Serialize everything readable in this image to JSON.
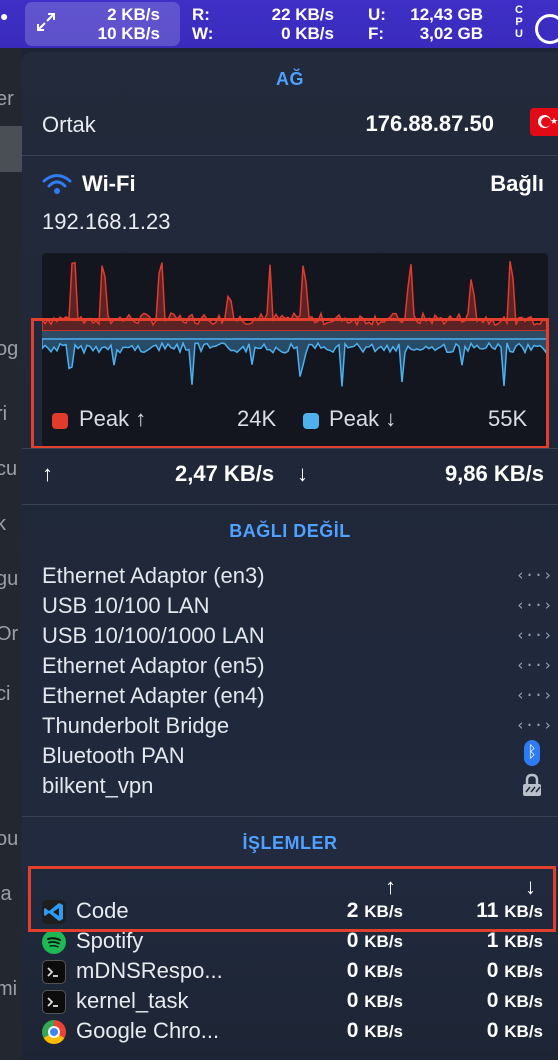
{
  "menubar": {
    "net_up": "2 KB/s",
    "net_down": "10 KB/s",
    "disk_r_label": "R:",
    "disk_r_value": "22 KB/s",
    "disk_w_label": "W:",
    "disk_w_value": "0 KB/s",
    "mem_u_label": "U:",
    "mem_u_value": "12,43 GB",
    "mem_f_label": "F:",
    "mem_f_value": "3,02 GB",
    "cpu_label": "CPU"
  },
  "network": {
    "title": "AĞ",
    "public_label": "Ortak",
    "public_ip": "176.88.87.50",
    "flag_icon": "turkey-flag-icon",
    "wifi_label": "Wi-Fi",
    "wifi_status": "Bağlı",
    "local_ip": "192.168.1.23",
    "legend_up_label": "Peak ↑",
    "legend_up_value": "24K",
    "legend_down_label": "Peak ↓",
    "legend_down_value": "55K",
    "up_arrow": "↑",
    "up_speed": "2,47 KB/s",
    "down_arrow": "↓",
    "down_speed": "9,86 KB/s",
    "colors": {
      "upload": "#e23b2e",
      "download": "#4fb0ee",
      "section_title": "#4fa0ff"
    }
  },
  "disconnected": {
    "title": "BAĞLI DEĞİL",
    "adapters": [
      {
        "name": "Ethernet Adaptor (en3)",
        "icon": "ethernet-icon"
      },
      {
        "name": "USB 10/100 LAN",
        "icon": "ethernet-icon"
      },
      {
        "name": "USB 10/100/1000 LAN",
        "icon": "ethernet-icon"
      },
      {
        "name": "Ethernet Adaptor (en5)",
        "icon": "ethernet-icon"
      },
      {
        "name": "Ethernet Adapter (en4)",
        "icon": "ethernet-icon"
      },
      {
        "name": "Thunderbolt Bridge",
        "icon": "ethernet-icon"
      },
      {
        "name": "Bluetooth PAN",
        "icon": "bluetooth-icon"
      },
      {
        "name": "bilkent_vpn",
        "icon": "vpn-lock-icon"
      }
    ]
  },
  "processes": {
    "title": "İŞLEMLER",
    "up_header": "↑",
    "down_header": "↓",
    "unit": "KB/s",
    "rows": [
      {
        "name": "Code",
        "up": "2",
        "down": "11",
        "icon": "vscode-icon"
      },
      {
        "name": "Spotify",
        "up": "0",
        "down": "1",
        "icon": "spotify-icon"
      },
      {
        "name": "mDNSRespo...",
        "up": "0",
        "down": "0",
        "icon": "terminal-icon"
      },
      {
        "name": "kernel_task",
        "up": "0",
        "down": "0",
        "icon": "terminal-icon"
      },
      {
        "name": "Google Chro...",
        "up": "0",
        "down": "0",
        "icon": "chrome-icon"
      }
    ]
  }
}
